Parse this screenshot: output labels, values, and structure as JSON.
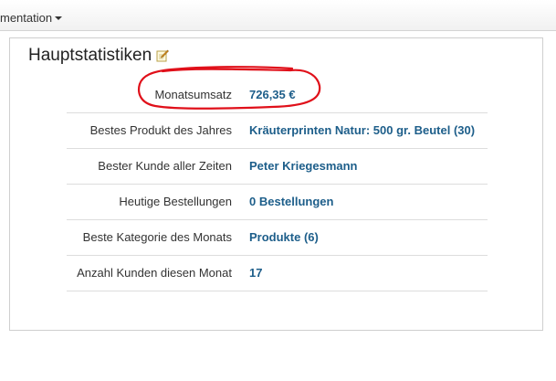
{
  "topbar": {
    "menu_label": "mentation"
  },
  "panel": {
    "title": "Hauptstatistiken",
    "edit_icon": "edit-pencil-icon",
    "rows": [
      {
        "label": "Monatsumsatz",
        "value": "726,35 €"
      },
      {
        "label": "Bestes Produkt des Jahres",
        "value": "Kräuterprinten Natur: 500 gr. Beutel (30)"
      },
      {
        "label": "Bester Kunde aller Zeiten",
        "value": "Peter Kriegesmann"
      },
      {
        "label": "Heutige Bestellungen",
        "value": "0 Bestellungen"
      },
      {
        "label": "Beste Kategorie des Monats",
        "value": "Produkte (6)"
      },
      {
        "label": "Anzahl Kunden diesen Monat",
        "value": "17"
      }
    ]
  },
  "colors": {
    "value_link": "#1d5e8a",
    "highlight_ring": "#e0101a"
  }
}
